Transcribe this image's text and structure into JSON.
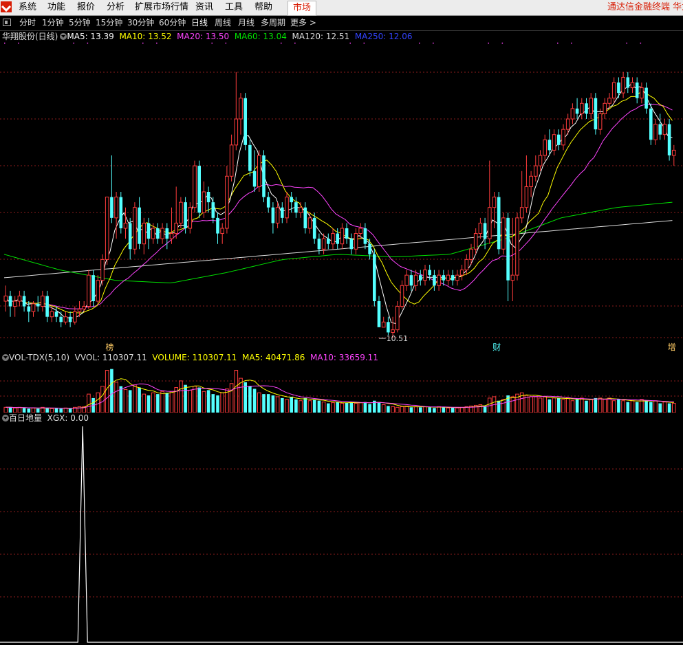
{
  "menu": {
    "items": [
      "系统",
      "功能",
      "报价",
      "分析",
      "扩展市场行情",
      "资讯",
      "工具",
      "帮助"
    ],
    "market_button": "市场",
    "app_title": "通达信金融终端  华龙"
  },
  "periods": {
    "tabs": [
      "分时",
      "1分钟",
      "5分钟",
      "15分钟",
      "30分钟",
      "60分钟",
      "日线",
      "周线",
      "月线",
      "多周期"
    ],
    "active": "日线",
    "more": "更多 >"
  },
  "main_info": {
    "stock_label": "华翔股份(日线)",
    "ma5": "MA5: 13.39",
    "ma10": "MA10: 13.52",
    "ma20": "MA20: 13.50",
    "ma60": "MA60: 13.04",
    "ma120": "MA120: 12.51",
    "ma250": "MA250: 12.06"
  },
  "vol_info": {
    "label": "VOL-TDX(5,10)",
    "vvol": "VVOL: 110307.11",
    "volume": "VOLUME: 110307.11",
    "ma5": "MA5: 40471.86",
    "ma10": "MA10: 33659.11"
  },
  "ind_info": {
    "label": "百日地量",
    "xgx": "XGX: 0.00"
  },
  "markers": [
    {
      "text": "榜",
      "index": 22
    },
    {
      "text": "财",
      "index": 106
    },
    {
      "text": "增",
      "index": 144
    }
  ],
  "low_label": "10.51",
  "colors": {
    "up": "#ff3c3c",
    "down": "#54ffff",
    "ma5": "#ffffff",
    "ma10": "#ffff00",
    "ma20": "#ff44ff",
    "ma60": "#00e000",
    "ma120": "#dddddd",
    "ma250": "#2222ff",
    "grid": "#8c1b1b"
  },
  "chart_data": {
    "type": "candlestick",
    "y_range": [
      10.3,
      15.9
    ],
    "candles": [
      [
        11.0,
        11.1,
        11.3,
        10.8
      ],
      [
        11.1,
        10.9,
        11.2,
        10.7
      ],
      [
        10.9,
        11.0,
        11.1,
        10.7
      ],
      [
        11.0,
        11.1,
        11.2,
        10.9
      ],
      [
        11.1,
        10.9,
        11.2,
        10.8
      ],
      [
        10.9,
        10.8,
        11.0,
        10.6
      ],
      [
        10.8,
        10.95,
        11.0,
        10.7
      ],
      [
        10.95,
        10.9,
        11.1,
        10.8
      ],
      [
        10.9,
        11.1,
        11.2,
        10.8
      ],
      [
        11.1,
        10.7,
        11.2,
        10.6
      ],
      [
        10.7,
        10.8,
        10.9,
        10.6
      ],
      [
        10.8,
        10.7,
        10.9,
        10.6
      ],
      [
        10.7,
        10.6,
        10.8,
        10.5
      ],
      [
        10.6,
        10.7,
        10.8,
        10.55
      ],
      [
        10.7,
        10.6,
        10.8,
        10.5
      ],
      [
        10.6,
        10.8,
        10.9,
        10.55
      ],
      [
        10.8,
        10.85,
        11.0,
        10.7
      ],
      [
        10.85,
        10.9,
        11.0,
        10.8
      ],
      [
        10.9,
        11.5,
        11.6,
        10.85
      ],
      [
        11.5,
        11.0,
        11.6,
        10.9
      ],
      [
        11.0,
        11.4,
        11.5,
        10.95
      ],
      [
        11.4,
        11.8,
        11.9,
        11.3
      ],
      [
        11.8,
        13.0,
        13.0,
        11.7
      ],
      [
        13.0,
        12.6,
        13.8,
        12.5
      ],
      [
        12.6,
        13.0,
        13.1,
        12.2
      ],
      [
        13.0,
        12.4,
        13.1,
        12.3
      ],
      [
        12.4,
        12.5,
        12.8,
        12.2
      ],
      [
        12.5,
        12.0,
        12.6,
        11.8
      ],
      [
        12.0,
        12.8,
        12.9,
        11.9
      ],
      [
        12.8,
        12.1,
        13.0,
        12.0
      ],
      [
        12.1,
        12.5,
        12.6,
        11.9
      ],
      [
        12.5,
        12.2,
        12.6,
        12.0
      ],
      [
        12.2,
        12.4,
        12.5,
        12.1
      ],
      [
        12.4,
        12.2,
        12.5,
        12.1
      ],
      [
        12.2,
        12.4,
        12.5,
        12.1
      ],
      [
        12.4,
        12.2,
        12.5,
        12.0
      ],
      [
        12.2,
        12.3,
        12.8,
        12.1
      ],
      [
        12.3,
        12.5,
        13.2,
        12.2
      ],
      [
        12.5,
        12.9,
        13.0,
        12.4
      ],
      [
        12.9,
        12.4,
        13.0,
        12.3
      ],
      [
        12.4,
        12.8,
        12.9,
        12.3
      ],
      [
        12.8,
        13.6,
        13.7,
        12.7
      ],
      [
        13.6,
        12.7,
        13.7,
        12.6
      ],
      [
        12.7,
        13.1,
        13.3,
        12.6
      ],
      [
        13.1,
        12.9,
        13.2,
        12.7
      ],
      [
        12.9,
        12.6,
        13.0,
        12.5
      ],
      [
        12.6,
        12.3,
        12.7,
        12.1
      ],
      [
        12.3,
        12.4,
        12.5,
        12.1
      ],
      [
        12.4,
        13.4,
        13.6,
        12.3
      ],
      [
        13.4,
        14.0,
        14.2,
        13.3
      ],
      [
        14.0,
        14.5,
        15.4,
        13.9
      ],
      [
        14.5,
        14.9,
        15.0,
        14.2
      ],
      [
        14.9,
        14.0,
        15.0,
        13.9
      ],
      [
        14.0,
        13.5,
        14.1,
        13.4
      ],
      [
        13.5,
        13.2,
        13.9,
        13.1
      ],
      [
        13.2,
        13.8,
        13.9,
        13.1
      ],
      [
        13.8,
        13.0,
        13.9,
        12.9
      ],
      [
        13.0,
        12.8,
        13.1,
        12.7
      ],
      [
        12.8,
        12.5,
        12.9,
        12.3
      ],
      [
        12.5,
        12.8,
        12.9,
        12.4
      ],
      [
        12.8,
        12.6,
        12.9,
        12.5
      ],
      [
        12.6,
        13.0,
        13.1,
        12.5
      ],
      [
        13.0,
        12.9,
        13.1,
        12.7
      ],
      [
        12.9,
        12.7,
        13.0,
        12.6
      ],
      [
        12.7,
        12.8,
        12.9,
        12.6
      ],
      [
        12.8,
        12.4,
        12.9,
        12.3
      ],
      [
        12.4,
        12.6,
        12.7,
        12.3
      ],
      [
        12.6,
        12.2,
        12.7,
        12.1
      ],
      [
        12.2,
        12.0,
        12.3,
        11.9
      ],
      [
        12.0,
        12.2,
        12.3,
        11.9
      ],
      [
        12.2,
        12.1,
        12.3,
        12.0
      ],
      [
        12.1,
        12.3,
        12.4,
        12.0
      ],
      [
        12.3,
        12.1,
        12.4,
        12.0
      ],
      [
        12.1,
        12.4,
        12.5,
        12.0
      ],
      [
        12.4,
        12.2,
        12.5,
        12.1
      ],
      [
        12.2,
        12.0,
        12.3,
        11.9
      ],
      [
        12.0,
        12.3,
        12.4,
        11.9
      ],
      [
        12.3,
        12.4,
        12.5,
        12.2
      ],
      [
        12.4,
        12.1,
        12.5,
        12.0
      ],
      [
        12.1,
        11.9,
        12.2,
        11.8
      ],
      [
        11.9,
        11.0,
        12.0,
        10.9
      ],
      [
        11.0,
        10.5,
        11.1,
        10.51
      ],
      [
        10.5,
        10.6,
        10.7,
        10.51
      ],
      [
        10.6,
        10.4,
        10.7,
        10.35
      ],
      [
        10.4,
        10.45,
        10.7,
        10.3
      ],
      [
        10.45,
        10.9,
        11.0,
        10.4
      ],
      [
        10.9,
        11.3,
        11.4,
        10.85
      ],
      [
        11.3,
        11.5,
        11.6,
        11.2
      ],
      [
        11.5,
        11.3,
        11.6,
        11.2
      ],
      [
        11.3,
        11.5,
        11.6,
        11.2
      ],
      [
        11.5,
        11.4,
        11.6,
        11.3
      ],
      [
        11.4,
        11.6,
        11.7,
        11.3
      ],
      [
        11.6,
        11.5,
        11.7,
        11.4
      ],
      [
        11.5,
        11.3,
        11.6,
        11.2
      ],
      [
        11.3,
        11.5,
        11.6,
        11.2
      ],
      [
        11.5,
        11.4,
        11.6,
        11.3
      ],
      [
        11.4,
        11.5,
        11.6,
        11.3
      ],
      [
        11.5,
        11.4,
        11.6,
        11.3
      ],
      [
        11.4,
        11.5,
        11.6,
        11.3
      ],
      [
        11.5,
        11.6,
        11.7,
        11.4
      ],
      [
        11.6,
        11.8,
        11.9,
        11.5
      ],
      [
        11.8,
        12.0,
        12.1,
        11.7
      ],
      [
        12.0,
        12.3,
        12.4,
        11.9
      ],
      [
        12.3,
        12.5,
        12.6,
        12.2
      ],
      [
        12.5,
        12.2,
        12.6,
        12.0
      ],
      [
        12.2,
        12.8,
        13.7,
        12.1
      ],
      [
        12.8,
        13.0,
        13.1,
        12.4
      ],
      [
        13.0,
        12.0,
        13.1,
        11.9
      ],
      [
        12.0,
        12.6,
        12.7,
        11.9
      ],
      [
        12.6,
        11.4,
        12.7,
        11.0
      ],
      [
        11.4,
        11.5,
        12.6,
        11.0
      ],
      [
        11.5,
        12.6,
        12.7,
        11.4
      ],
      [
        12.6,
        12.8,
        13.5,
        12.5
      ],
      [
        12.8,
        13.2,
        13.8,
        12.7
      ],
      [
        13.2,
        13.4,
        13.5,
        13.0
      ],
      [
        13.4,
        13.6,
        13.8,
        13.3
      ],
      [
        13.6,
        13.8,
        13.9,
        13.5
      ],
      [
        13.8,
        14.1,
        14.2,
        13.7
      ],
      [
        14.1,
        13.9,
        14.3,
        13.8
      ],
      [
        13.9,
        14.2,
        14.3,
        13.8
      ],
      [
        14.2,
        14.0,
        14.3,
        13.9
      ],
      [
        14.0,
        14.3,
        14.4,
        13.9
      ],
      [
        14.3,
        14.5,
        14.6,
        14.2
      ],
      [
        14.5,
        14.7,
        14.8,
        14.4
      ],
      [
        14.7,
        14.6,
        14.9,
        14.5
      ],
      [
        14.6,
        14.8,
        14.9,
        14.5
      ],
      [
        14.8,
        14.6,
        14.9,
        14.5
      ],
      [
        14.6,
        14.9,
        15.0,
        14.5
      ],
      [
        14.9,
        14.3,
        15.0,
        14.2
      ],
      [
        14.3,
        14.6,
        14.7,
        14.2
      ],
      [
        14.6,
        14.8,
        14.9,
        14.5
      ],
      [
        14.8,
        14.9,
        15.0,
        14.7
      ],
      [
        14.9,
        15.2,
        15.3,
        14.8
      ],
      [
        15.2,
        15.0,
        15.3,
        14.9
      ],
      [
        15.0,
        15.3,
        15.4,
        14.9
      ],
      [
        15.3,
        15.1,
        15.4,
        15.0
      ],
      [
        15.1,
        15.2,
        15.3,
        15.0
      ],
      [
        15.2,
        14.9,
        15.3,
        14.8
      ],
      [
        14.9,
        15.1,
        15.2,
        14.8
      ],
      [
        15.1,
        14.7,
        15.2,
        14.6
      ],
      [
        14.7,
        14.1,
        14.8,
        14.0
      ],
      [
        14.1,
        14.4,
        14.5,
        14.0
      ],
      [
        14.4,
        14.2,
        14.6,
        14.1
      ],
      [
        14.2,
        14.4,
        14.5,
        14.1
      ],
      [
        14.4,
        13.8,
        14.5,
        13.7
      ],
      [
        13.8,
        13.9,
        14.0,
        13.6
      ]
    ],
    "volumes": [
      8,
      8,
      7,
      8,
      7,
      6,
      7,
      6,
      8,
      7,
      6,
      7,
      6,
      7,
      6,
      8,
      9,
      9,
      28,
      22,
      30,
      40,
      64,
      66,
      46,
      40,
      35,
      34,
      42,
      38,
      28,
      26,
      30,
      28,
      32,
      30,
      32,
      38,
      48,
      42,
      34,
      40,
      38,
      32,
      34,
      28,
      26,
      30,
      36,
      44,
      64,
      52,
      46,
      40,
      36,
      30,
      28,
      28,
      26,
      24,
      22,
      20,
      24,
      20,
      18,
      22,
      18,
      20,
      18,
      16,
      14,
      15,
      16,
      14,
      15,
      16,
      14,
      15,
      16,
      13,
      18,
      16,
      12,
      10,
      9,
      8,
      9,
      10,
      8,
      9,
      8,
      9,
      8,
      7,
      9,
      8,
      7,
      8,
      7,
      8,
      9,
      10,
      11,
      12,
      10,
      22,
      24,
      18,
      20,
      26,
      24,
      28,
      30,
      26,
      24,
      24,
      22,
      24,
      20,
      22,
      22,
      20,
      22,
      18,
      20,
      22,
      18,
      20,
      22,
      22,
      20,
      22,
      18,
      20,
      18,
      16,
      18,
      16,
      20,
      18,
      16,
      18,
      14,
      16,
      14,
      14
    ],
    "vol_max": 75,
    "indicator": {
      "name": "XGX",
      "spike_index": 17,
      "values_note": "0 except one spike to 1"
    },
    "ma_lines": {
      "ma5": "MA5",
      "ma10": "MA10",
      "ma20": "MA20",
      "ma60": "MA60",
      "ma120": "MA120"
    }
  }
}
